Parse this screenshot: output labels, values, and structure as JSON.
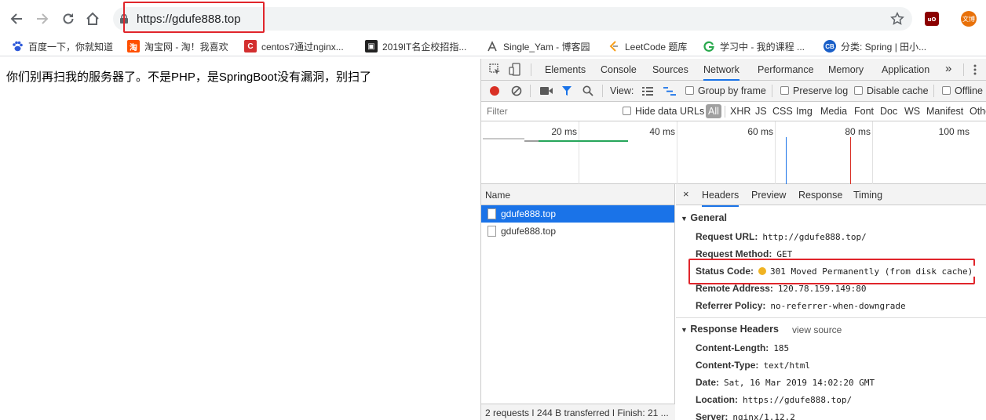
{
  "browser": {
    "url": "https://gdufe888.top",
    "extensions": [
      "ublock-icon",
      "avatar"
    ],
    "avatar_label": "文博"
  },
  "bookmarks": [
    {
      "icon": "paw-icon",
      "label": "百度一下，你就知道",
      "color": "#2e59d9"
    },
    {
      "icon": "taobao-icon",
      "label": "淘宝网 - 淘！我喜欢",
      "color": "#ff5000"
    },
    {
      "icon": "c-icon",
      "label": "centos7通过nginx...",
      "color": "#d32f2f"
    },
    {
      "icon": "square-icon",
      "label": "2019IT名企校招指...",
      "color": "#222"
    },
    {
      "icon": "profile-icon",
      "label": "Single_Yam - 博客园",
      "color": "#555"
    },
    {
      "icon": "leetcode-icon",
      "label": "LeetCode 题库",
      "color": "#f89f1b"
    },
    {
      "icon": "g-icon",
      "label": "学习中 - 我的课程 ...",
      "color": "#2aa94e"
    },
    {
      "icon": "cb-icon",
      "label": "分类: Spring | 田小...",
      "color": "#1a5fc8"
    }
  ],
  "page": {
    "text": "你们别再扫我的服务器了。不是PHP，是SpringBoot没有漏洞，别扫了"
  },
  "devtools": {
    "tabs": [
      "Elements",
      "Console",
      "Sources",
      "Network",
      "Performance",
      "Memory",
      "Application"
    ],
    "more": "»",
    "view_label": "View:",
    "group_by_frame": "Group by frame",
    "preserve_log": "Preserve log",
    "disable_cache": "Disable cache",
    "offline": "Offline",
    "filter_placeholder": "Filter",
    "hide_data_urls": "Hide data URLs",
    "filter_types": [
      "All",
      "XHR",
      "JS",
      "CSS",
      "Img",
      "Media",
      "Font",
      "Doc",
      "WS",
      "Manifest",
      "Othe"
    ],
    "timeline_ticks": [
      "20 ms",
      "40 ms",
      "60 ms",
      "80 ms",
      "100 ms"
    ],
    "name_header": "Name",
    "requests": [
      "gdufe888.top",
      "gdufe888.top"
    ],
    "status_bar": "2 requests ǀ 244 B transferred ǀ Finish: 21 ...",
    "detail_tabs": [
      "Headers",
      "Preview",
      "Response",
      "Timing"
    ],
    "general": {
      "title": "General",
      "request_url_k": "Request URL:",
      "request_url_v": "http://gdufe888.top/",
      "request_method_k": "Request Method:",
      "request_method_v": "GET",
      "status_code_k": "Status Code:",
      "status_code_v": "301 Moved Permanently (from disk cache)",
      "remote_address_k": "Remote Address:",
      "remote_address_v": "120.78.159.149:80",
      "referrer_policy_k": "Referrer Policy:",
      "referrer_policy_v": "no-referrer-when-downgrade"
    },
    "response_headers": {
      "title": "Response Headers",
      "view_source": "view source",
      "content_length_k": "Content-Length:",
      "content_length_v": "185",
      "content_type_k": "Content-Type:",
      "content_type_v": "text/html",
      "date_k": "Date:",
      "date_v": "Sat, 16 Mar 2019 14:02:20 GMT",
      "location_k": "Location:",
      "location_v": "https://gdufe888.top/",
      "server_k": "Server:",
      "server_v": "nginx/1.12.2"
    }
  }
}
